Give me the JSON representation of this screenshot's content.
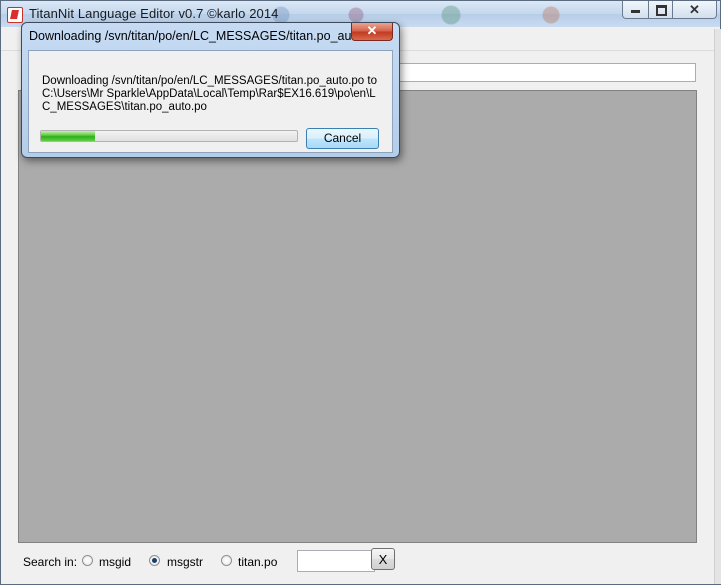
{
  "main_window": {
    "title": "TitanNit Language Editor v0.7 ©karlo 2014",
    "buttons": {
      "close": "✕"
    }
  },
  "search": {
    "label": "Search in:",
    "options": [
      {
        "label": "msgid",
        "checked": false
      },
      {
        "label": "msgstr",
        "checked": true
      },
      {
        "label": "titan.po",
        "checked": false
      }
    ],
    "input_value": "",
    "clear_label": "X"
  },
  "dialog": {
    "title": "Downloading /svn/titan/po/en/LC_MESSAGES/titan.po_au...",
    "close_label": "✕",
    "message": "Downloading /svn/titan/po/en/LC_MESSAGES/titan.po_auto.po to C:\\Users\\Mr Sparkle\\AppData\\Local\\Temp\\Rar$EX16.619\\po\\en\\LC_MESSAGES\\titan.po_auto.po",
    "progress_fraction": 0.21,
    "cancel_label": "Cancel"
  },
  "colors": {
    "panel": "#ababab",
    "progress": "#2fae18",
    "dialog_frame": "#b4cde9"
  }
}
